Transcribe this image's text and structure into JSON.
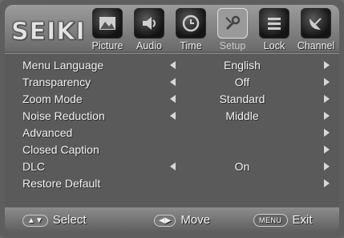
{
  "brand": "SEIKI",
  "tabs": [
    {
      "label": "Picture",
      "icon": "picture-icon"
    },
    {
      "label": "Audio",
      "icon": "audio-icon"
    },
    {
      "label": "Time",
      "icon": "clock-icon"
    },
    {
      "label": "Setup",
      "icon": "setup-icon",
      "selected": true
    },
    {
      "label": "Lock",
      "icon": "lock-icon"
    },
    {
      "label": "Channel",
      "icon": "satellite-dish-icon"
    }
  ],
  "menu": {
    "rows": [
      {
        "label": "Menu Language",
        "value": "English"
      },
      {
        "label": "Transparency",
        "value": "Off"
      },
      {
        "label": "Zoom Mode",
        "value": "Standard"
      },
      {
        "label": "Noise Reduction",
        "value": "Middle"
      },
      {
        "label": "Advanced",
        "value": ""
      },
      {
        "label": "Closed Caption",
        "value": ""
      },
      {
        "label": "DLC",
        "value": "On"
      },
      {
        "label": "Restore Default",
        "value": ""
      }
    ]
  },
  "footer": {
    "select_label": "Select",
    "move_label": "Move",
    "menu_key": "MENU",
    "exit_label": "Exit"
  }
}
